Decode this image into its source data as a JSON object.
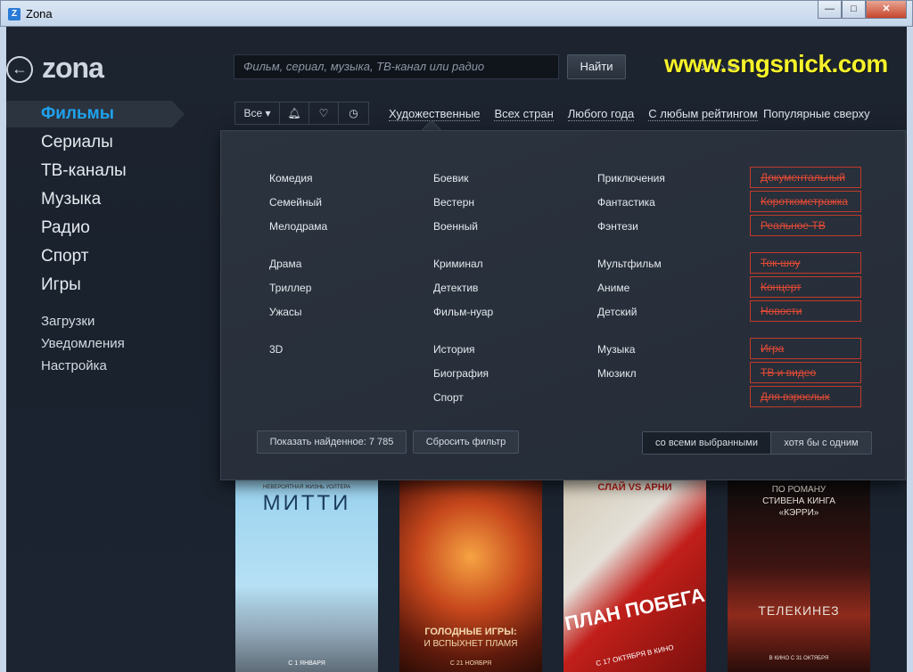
{
  "window": {
    "title": "Zona",
    "icon": "Z",
    "buttons": [
      "—",
      "□",
      "✕"
    ]
  },
  "app": {
    "logo": "zona"
  },
  "nav": {
    "main": [
      "Фильмы",
      "Сериалы",
      "ТВ-каналы",
      "Музыка",
      "Радио",
      "Спорт",
      "Игры"
    ],
    "sub": [
      "Загрузки",
      "Уведомления",
      "Настройка"
    ]
  },
  "search": {
    "placeholder": "Фильм, сериал, музыка, ТВ-канал или радио",
    "button": "Найти"
  },
  "watermark": "www.sngsnick.com",
  "filterbar": {
    "all": "Все ▾",
    "icons": [
      "bell-icon",
      "heart-icon",
      "clock-icon"
    ],
    "links": [
      "Художественные",
      "Всех стран",
      "Любого года",
      "С любым рейтингом"
    ],
    "sort": "Популярные сверху"
  },
  "genres": {
    "col1": [
      "Комедия",
      "Семейный",
      "Мелодрама",
      "Драма",
      "Триллер",
      "Ужасы",
      "3D"
    ],
    "col2": [
      "Боевик",
      "Вестерн",
      "Военный",
      "Криминал",
      "Детектив",
      "Фильм-нуар",
      "История",
      "Биография",
      "Спорт"
    ],
    "col3": [
      "Приключения",
      "Фантастика",
      "Фэнтези",
      "Мультфильм",
      "Аниме",
      "Детский",
      "Музыка",
      "Мюзикл"
    ],
    "excluded": [
      "Документальный",
      "Короткометражка",
      "Реальное ТВ",
      "Ток-шоу",
      "Концерт",
      "Новости",
      "Игра",
      "ТВ и видео",
      "Для взрослых"
    ]
  },
  "panel_actions": {
    "show_found": "Показать найденное: 7 785",
    "reset": "Сбросить фильтр",
    "match_all": "со всеми выбранными",
    "match_any": "хотя бы с одним"
  },
  "posters": [
    {
      "tagline": "НЕВЕРОЯТНАЯ ЖИЗНЬ УОЛТЕРА",
      "title": "МИТТИ",
      "date": "С 1 ЯНВАРЯ"
    },
    {
      "title": "ГОЛОДНЫЕ ИГРЫ:",
      "subtitle": "И ВСПЫХНЕТ ПЛАМЯ",
      "date": "С 21 НОЯБРЯ"
    },
    {
      "top": "СЛАЙ VS АРНИ",
      "title": "ПЛАН ПОБЕГА",
      "date": "С 17 ОКТЯБРЯ В КИНО"
    },
    {
      "tagline": "ПО РОМАНУ СТИВЕНА КИНГА «КЭРРИ»",
      "title": "ТЕЛЕКИНЕЗ",
      "date": "В КИНО С 31 ОКТЯБРЯ"
    }
  ]
}
